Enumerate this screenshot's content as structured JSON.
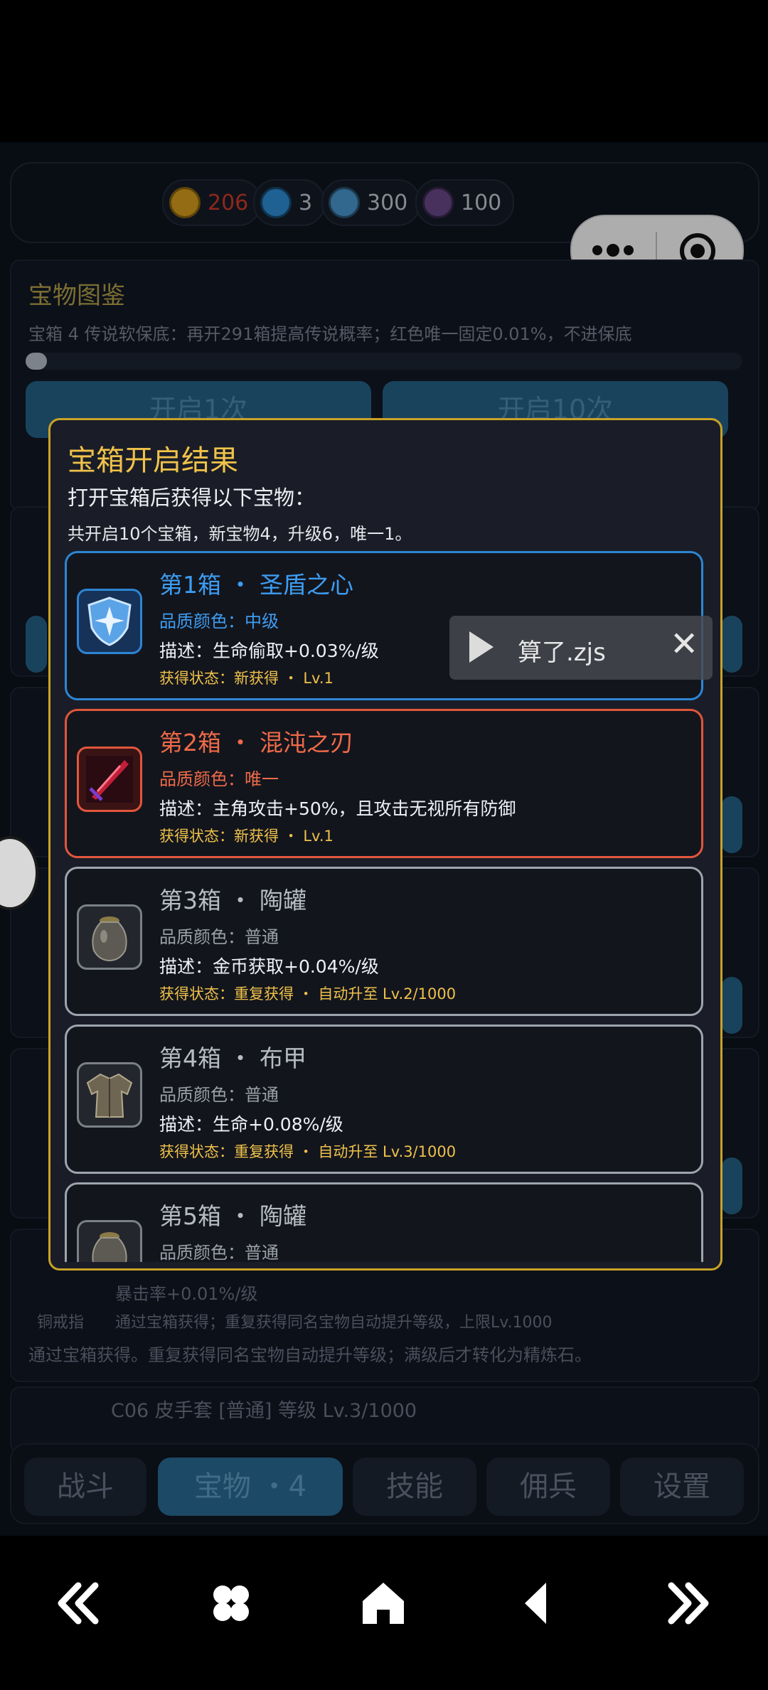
{
  "resources": [
    {
      "icon": "gold-coin-icon",
      "value": "206",
      "color": "#d9a01c",
      "text_color": "#d33a2a"
    },
    {
      "icon": "blue-gem-icon",
      "value": "3",
      "color": "#2f8fd8",
      "text_color": "#c7ccd6"
    },
    {
      "icon": "crystal-icon",
      "value": "300",
      "color": "#4a9ad0",
      "text_color": "#c7ccd6"
    },
    {
      "icon": "purple-gem-icon",
      "value": "100",
      "color": "#6a4a8a",
      "text_color": "#c7ccd6"
    }
  ],
  "background": {
    "section_title": "宝物图鉴",
    "pity_text": "宝箱 4   传说软保底：再开291箱提高传说概率；红色唯一固定0.01%，不进保底",
    "open_once": "开启1次",
    "open_ten": "开启10次",
    "card_lines": {
      "crit": "暴击率+0.01%/级",
      "tag": "铜戒指",
      "source": "通过宝箱获得；重复获得同名宝物自动提升等级，上限Lv.1000",
      "note": "通过宝箱获得。重复获得同名宝物自动提升等级；满级后才转化为精炼石。",
      "next_item": "C06 皮手套 [普通] 等级 Lv.3/1000"
    }
  },
  "tabs": [
    {
      "label": "战斗",
      "active": false
    },
    {
      "label": "宝物 ・4",
      "active": true
    },
    {
      "label": "技能",
      "active": false
    },
    {
      "label": "佣兵",
      "active": false
    },
    {
      "label": "设置",
      "active": false
    }
  ],
  "dialog": {
    "title": "宝箱开启结果",
    "subtitle": "打开宝箱后获得以下宝物：",
    "summary": "共开启10个宝箱，新宝物4，升级6，唯一1。",
    "items": [
      {
        "title": "第1箱  ・  圣盾之心",
        "quality": "品质颜色：中级",
        "desc": "描述：生命偷取+0.03%/级",
        "status": "获得状态：新获得  ・  Lv.1",
        "style": "blue",
        "icon": "holy-shield-icon"
      },
      {
        "title": "第2箱  ・  混沌之刃",
        "quality": "品质颜色：唯一",
        "desc": "描述：主角攻击+50%，且攻击无视所有防御",
        "status": "获得状态：新获得  ・  Lv.1",
        "style": "red",
        "icon": "chaos-blade-icon"
      },
      {
        "title": "第3箱  ・  陶罐",
        "quality": "品质颜色：普通",
        "desc": "描述：金币获取+0.04%/级",
        "status": "获得状态：重复获得  ・  自动升至 Lv.2/1000",
        "style": "gray",
        "icon": "clay-jar-icon"
      },
      {
        "title": "第4箱  ・  布甲",
        "quality": "品质颜色：普通",
        "desc": "描述：生命+0.08%/级",
        "status": "获得状态：重复获得  ・  自动升至 Lv.3/1000",
        "style": "gray",
        "icon": "cloth-armor-icon"
      },
      {
        "title": "第5箱  ・  陶罐",
        "quality": "品质颜色：普通",
        "desc": "",
        "status": "",
        "style": "gray",
        "icon": "clay-jar-icon"
      }
    ]
  },
  "toast": {
    "text": "算了.zjs"
  },
  "nav_icons": [
    "back-double-icon",
    "apps-icon",
    "home-icon",
    "back-icon",
    "forward-double-icon"
  ]
}
